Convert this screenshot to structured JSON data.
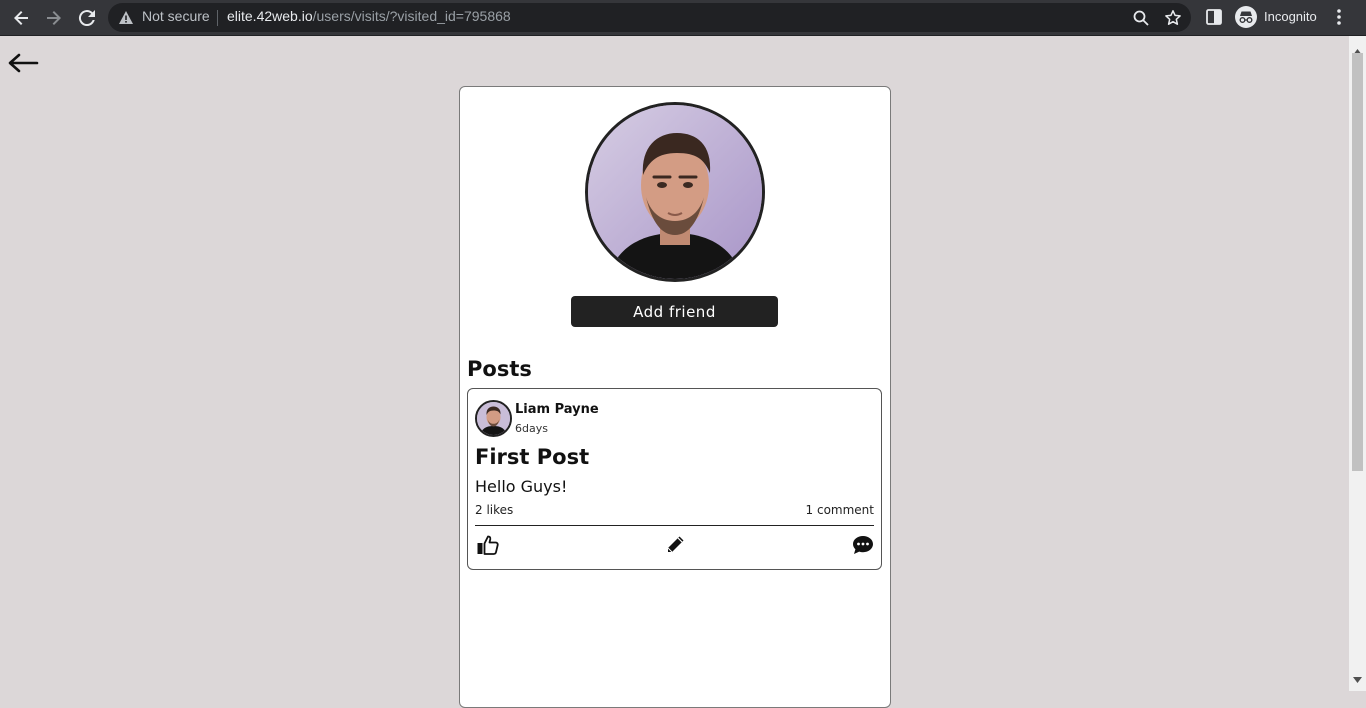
{
  "browser": {
    "security_label": "Not secure",
    "url_host": "elite.42web.io",
    "url_path": "/users/visits/?visited_id=795868",
    "profile_label": "Incognito",
    "icons": [
      "back-icon",
      "forward-icon",
      "reload-icon",
      "warning-icon",
      "zoom-icon",
      "bookmark-star-icon",
      "side-panel-icon",
      "incognito-icon",
      "menu-icon"
    ]
  },
  "profile": {
    "add_friend_label": "Add friend"
  },
  "posts": {
    "heading": "Posts",
    "items": [
      {
        "author": "Liam Payne",
        "time": "6days",
        "title": "First Post",
        "body": "Hello Guys!",
        "likes": "2 likes",
        "comments": "1 comment",
        "actions": [
          "like-icon",
          "edit-icon",
          "comment-icon"
        ]
      }
    ]
  },
  "colors": {
    "page_background": "#dcd7d8",
    "chrome_background": "#35363a",
    "button_background": "#222222"
  }
}
